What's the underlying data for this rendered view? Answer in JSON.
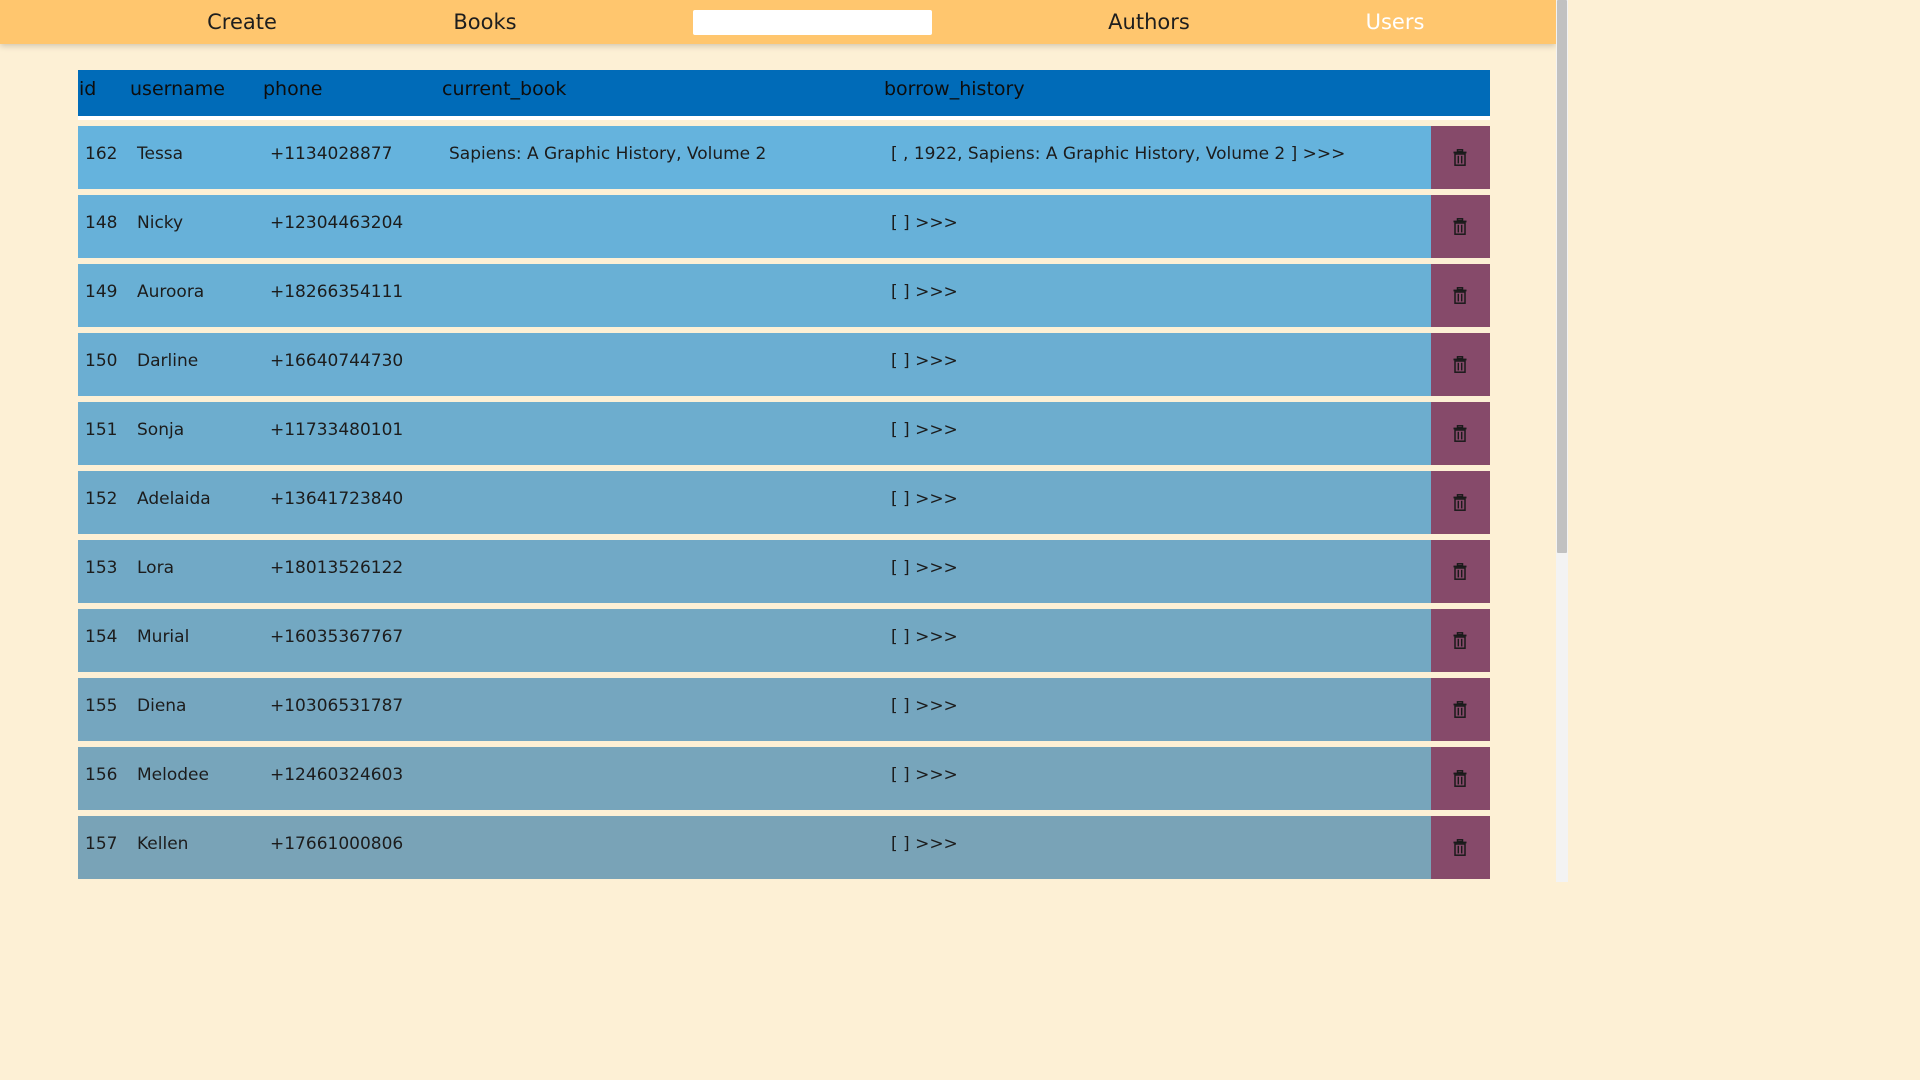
{
  "nav": {
    "create": "Create",
    "books": "Books",
    "search_value": "",
    "authors": "Authors",
    "users": "Users"
  },
  "table": {
    "headers": [
      "id",
      "username",
      "phone",
      "current_book",
      "borrow_history"
    ],
    "rows": [
      {
        "id": "162",
        "username": "Tessa",
        "phone": "+1134028877",
        "current_book": "Sapiens: A Graphic History, Volume 2",
        "borrow_history": "[ , 1922, Sapiens: A Graphic History, Volume 2 ] >>>"
      },
      {
        "id": "148",
        "username": "Nicky",
        "phone": "+12304463204",
        "current_book": "",
        "borrow_history": "[ ] >>>"
      },
      {
        "id": "149",
        "username": "Auroora",
        "phone": "+18266354111",
        "current_book": "",
        "borrow_history": "[ ] >>>"
      },
      {
        "id": "150",
        "username": "Darline",
        "phone": "+16640744730",
        "current_book": "",
        "borrow_history": "[ ] >>>"
      },
      {
        "id": "151",
        "username": "Sonja",
        "phone": "+11733480101",
        "current_book": "",
        "borrow_history": "[ ] >>>"
      },
      {
        "id": "152",
        "username": "Adelaida",
        "phone": "+13641723840",
        "current_book": "",
        "borrow_history": "[ ] >>>"
      },
      {
        "id": "153",
        "username": "Lora",
        "phone": "+18013526122",
        "current_book": "",
        "borrow_history": "[ ] >>>"
      },
      {
        "id": "154",
        "username": "Murial",
        "phone": "+16035367767",
        "current_book": "",
        "borrow_history": "[ ] >>>"
      },
      {
        "id": "155",
        "username": "Diena",
        "phone": "+10306531787",
        "current_book": "",
        "borrow_history": "[ ] >>>"
      },
      {
        "id": "156",
        "username": "Melodee",
        "phone": "+12460324603",
        "current_book": "",
        "borrow_history": "[ ] >>>"
      },
      {
        "id": "157",
        "username": "Kellen",
        "phone": "+17661000806",
        "current_book": "",
        "borrow_history": "[ ] >>>"
      }
    ]
  },
  "icons": {
    "delete": "trash-icon"
  },
  "colors": {
    "topbar": "#ffc66e",
    "page_background": "#fdf0d5",
    "header_row": "#006bb8",
    "delete_cell": "#864a6a",
    "row_gradient_start": "#65b3dd",
    "row_gradient_end": "#79a3b7",
    "active_nav": "#ffffff"
  }
}
